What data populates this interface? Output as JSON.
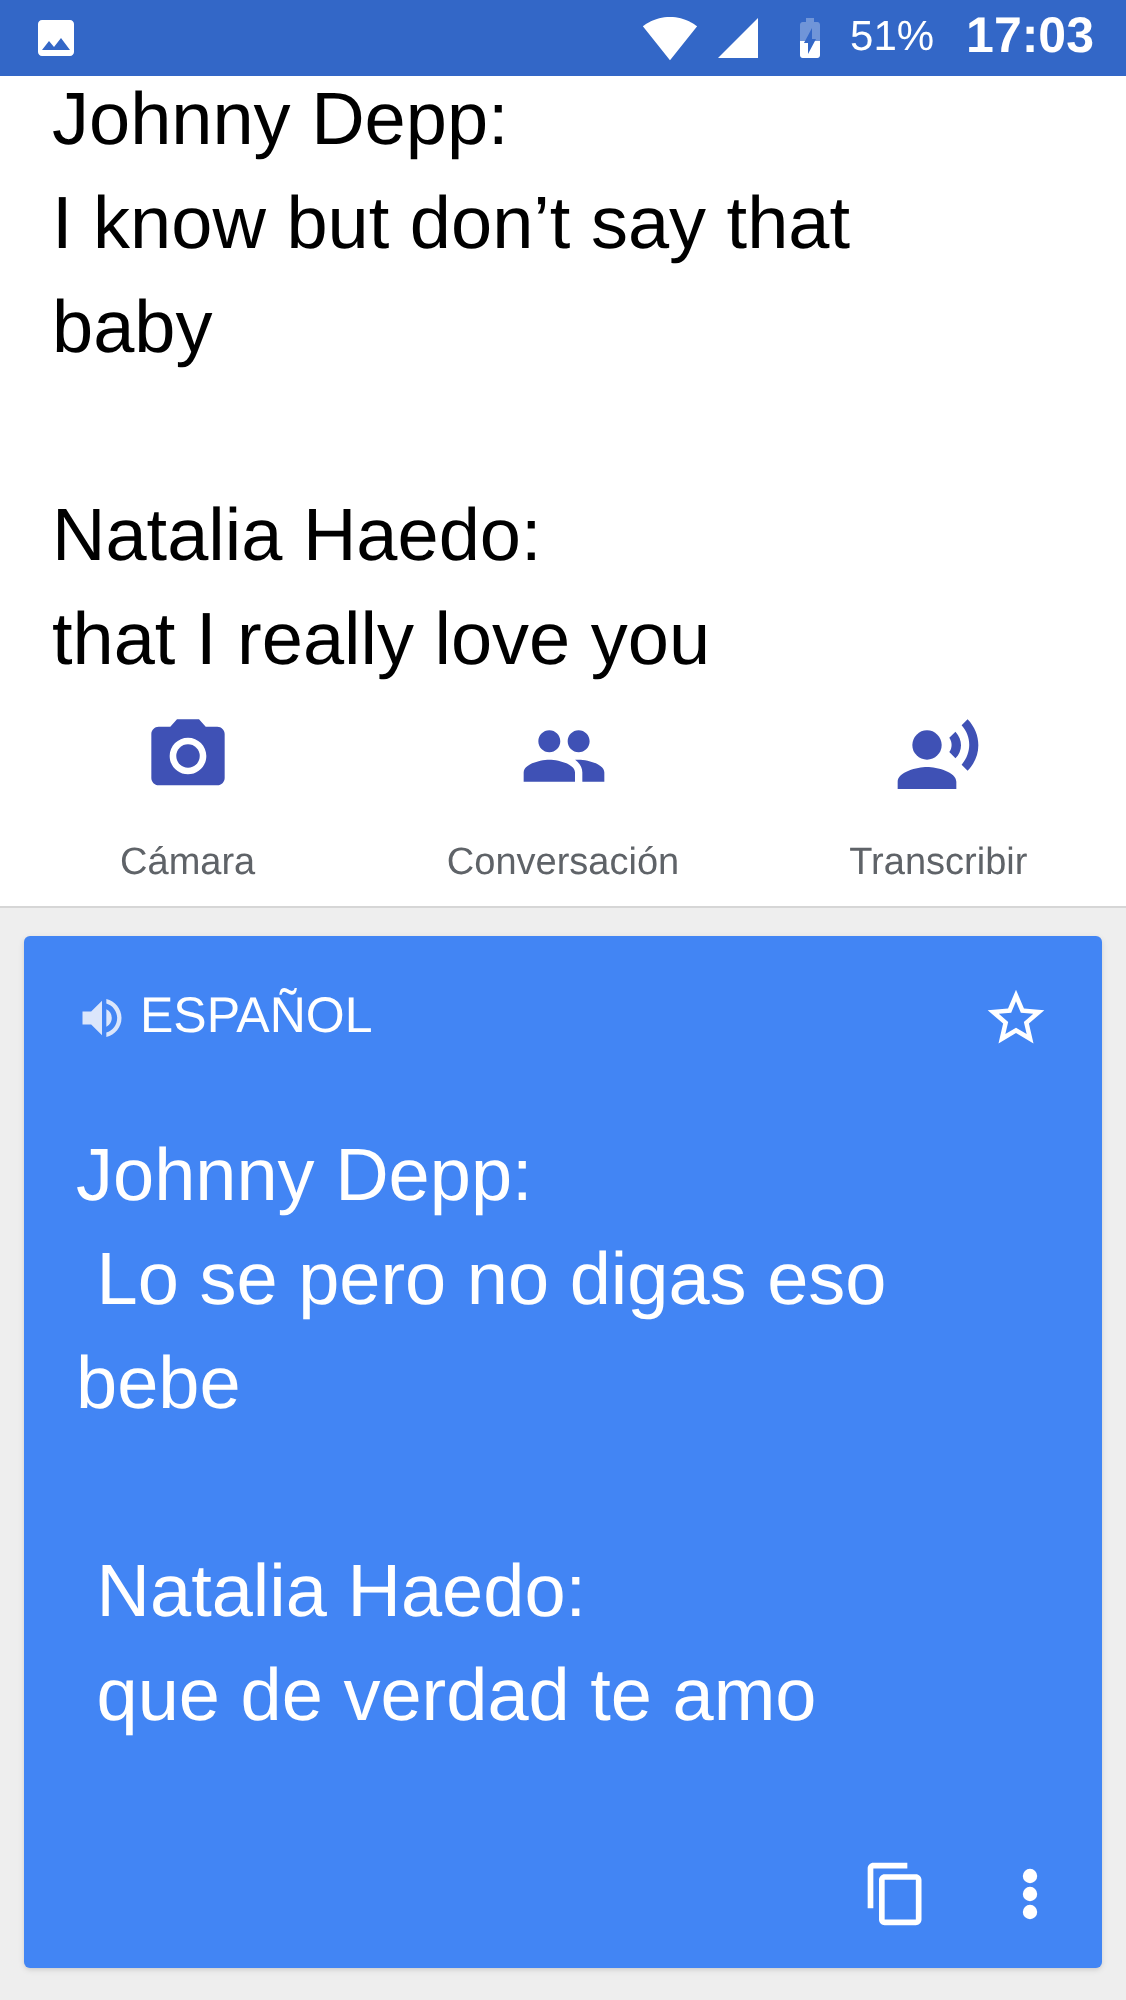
{
  "status_bar": {
    "battery": "51%",
    "time": "17:03"
  },
  "source_text": "Johnny Depp:\nI know but don’t say that baby\n\nNatalia Haedo:\nthat I really love you",
  "tools": [
    {
      "kind": "camera",
      "label": "Cámara"
    },
    {
      "kind": "conversation",
      "label": "Conversación"
    },
    {
      "kind": "transcribe",
      "label": "Transcribir"
    }
  ],
  "translation": {
    "language": "ESPAÑOL",
    "text": "Johnny Depp:\n Lo se pero no digas eso bebe\n\n Natalia Haedo:\n que de verdad te amo",
    "starred": false
  }
}
